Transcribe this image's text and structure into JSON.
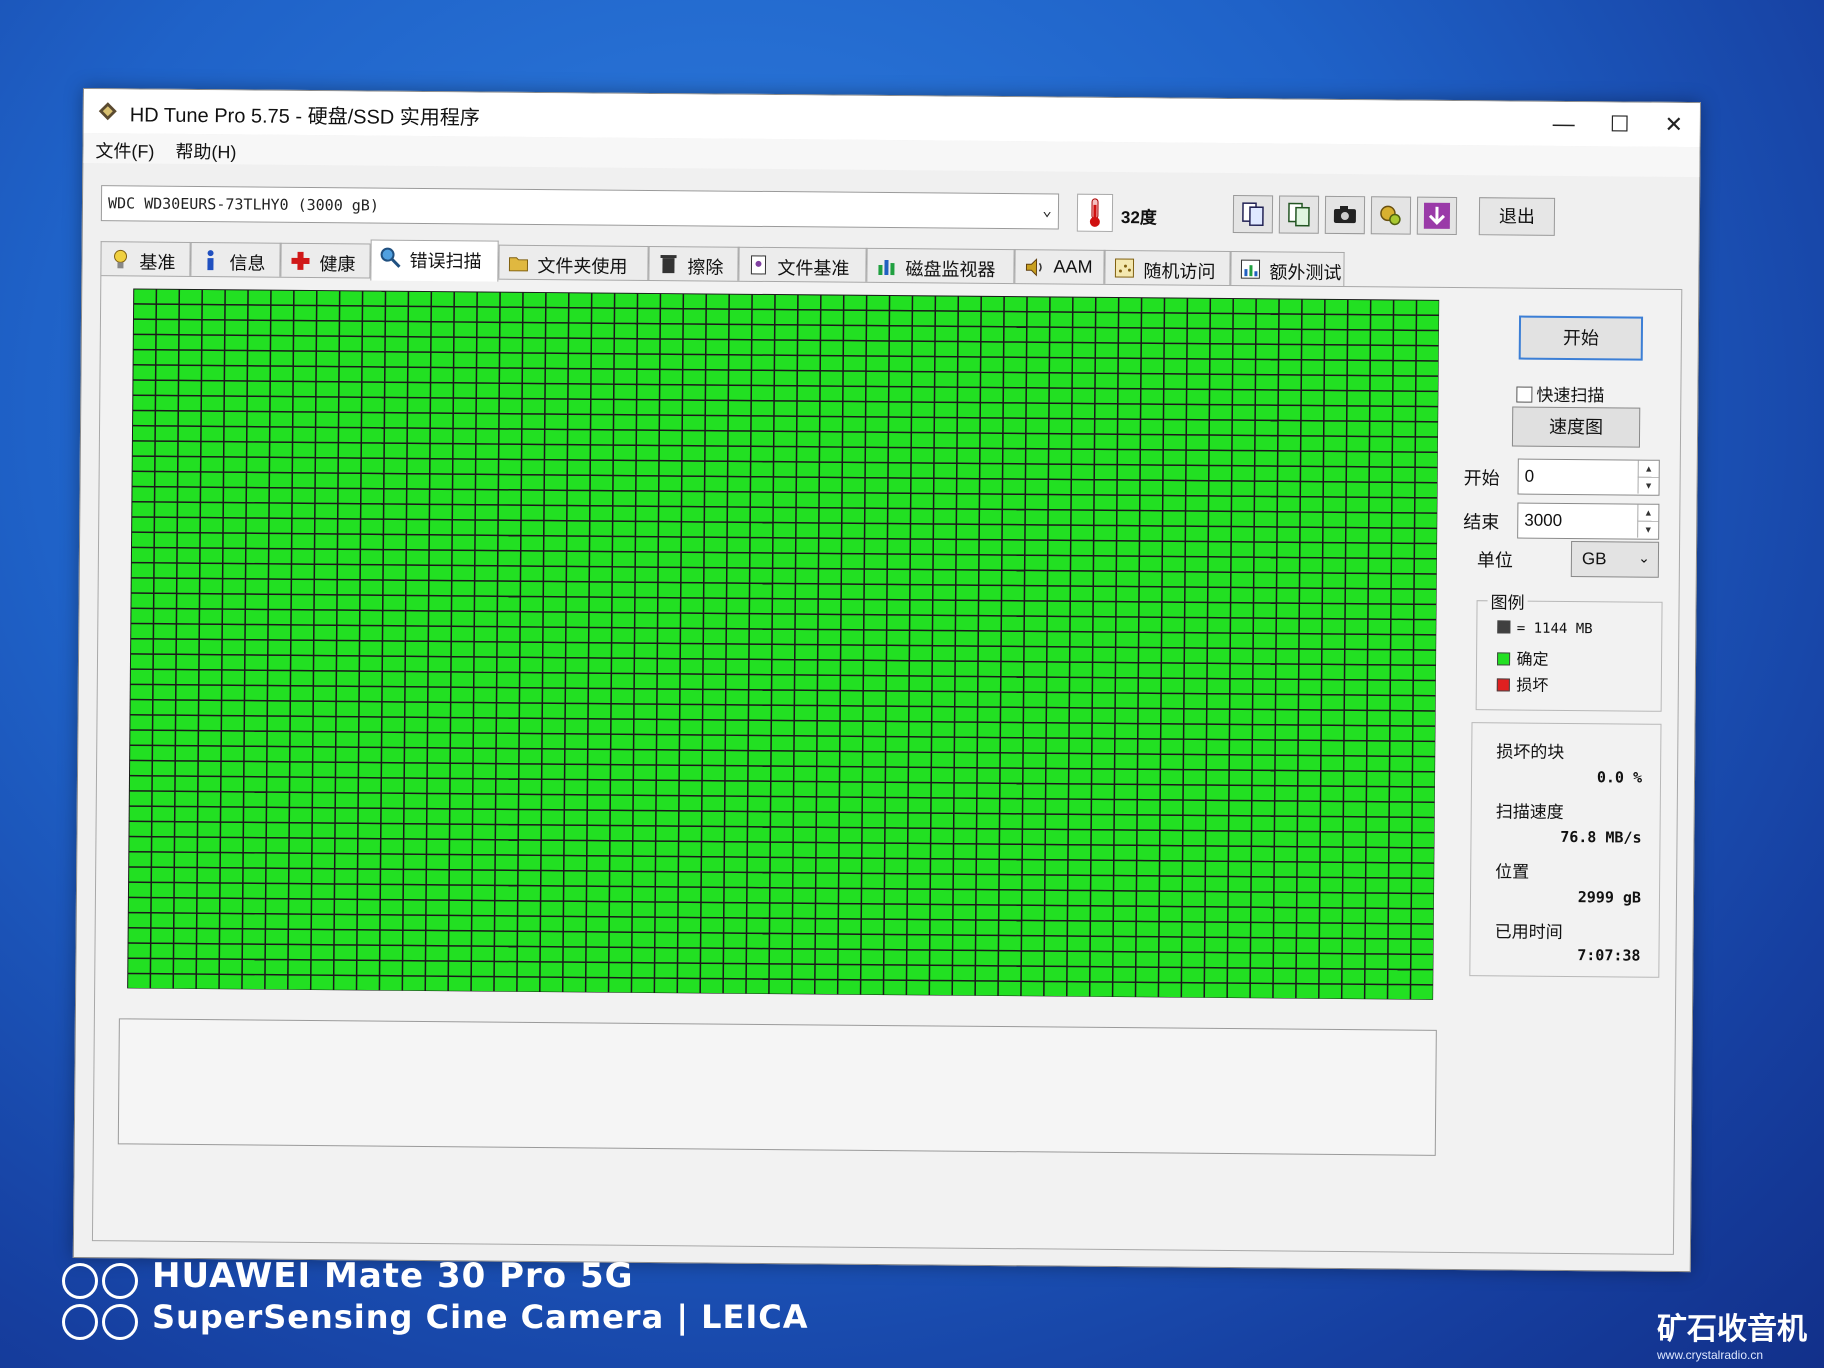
{
  "window": {
    "title": "HD Tune Pro 5.75 - 硬盘/SSD 实用程序",
    "minimize": "—",
    "maximize": "☐",
    "close": "✕"
  },
  "menu": [
    {
      "label": "文件(F)"
    },
    {
      "label": "帮助(H)"
    }
  ],
  "toolbar": {
    "drive": "WDC WD30EURS-73TLHY0 (3000 gB)",
    "temperature": "32度",
    "exit_label": "退出",
    "icons": [
      "copy-text-icon",
      "copy-info-icon",
      "camera-icon",
      "options-icon",
      "save-icon"
    ]
  },
  "tabs": [
    {
      "label": "基准",
      "icon": "bulb-icon"
    },
    {
      "label": "信息",
      "icon": "info-icon"
    },
    {
      "label": "健康",
      "icon": "cross-icon"
    },
    {
      "label": "错误扫描",
      "icon": "magnifier-icon",
      "active": true
    },
    {
      "label": "文件夹使用",
      "icon": "folder-icon"
    },
    {
      "label": "擦除",
      "icon": "trash-icon"
    },
    {
      "label": "文件基准",
      "icon": "file-icon"
    },
    {
      "label": "磁盘监视器",
      "icon": "bars-icon"
    },
    {
      "label": "AAM",
      "icon": "speaker-icon"
    },
    {
      "label": "随机访问",
      "icon": "dots-icon"
    },
    {
      "label": "额外测试",
      "icon": "tests-icon"
    }
  ],
  "scan": {
    "columns": 57,
    "rows": 46,
    "ok_fraction": 1.0,
    "colors": {
      "ok": "#22e022",
      "damaged": "#e02020",
      "block": "#404040"
    }
  },
  "controls": {
    "start_button": "开始",
    "quick_scan_label": "快速扫描",
    "quick_scan_checked": false,
    "speed_map_button": "速度图",
    "start_label": "开始",
    "start_value": "0",
    "end_label": "结束",
    "end_value": "3000",
    "unit_label": "单位",
    "unit_value": "GB"
  },
  "legend": {
    "title": "图例",
    "block_size": "= 1144 MB",
    "ok_label": "确定",
    "damaged_label": "损坏"
  },
  "stats": {
    "damaged_blocks_label": "损坏的块",
    "damaged_blocks_value": "0.0 %",
    "scan_speed_label": "扫描速度",
    "scan_speed_value": "76.8 MB/s",
    "position_label": "位置",
    "position_value": "2999 gB",
    "elapsed_label": "已用时间",
    "elapsed_value": "7:07:38"
  },
  "photo_watermark": {
    "line1": "HUAWEI Mate 30 Pro 5G",
    "line2": "SuperSensing Cine Camera | LEICA",
    "corner_logo": "矿石收音机",
    "corner_url": "www.crystalradio.cn"
  }
}
